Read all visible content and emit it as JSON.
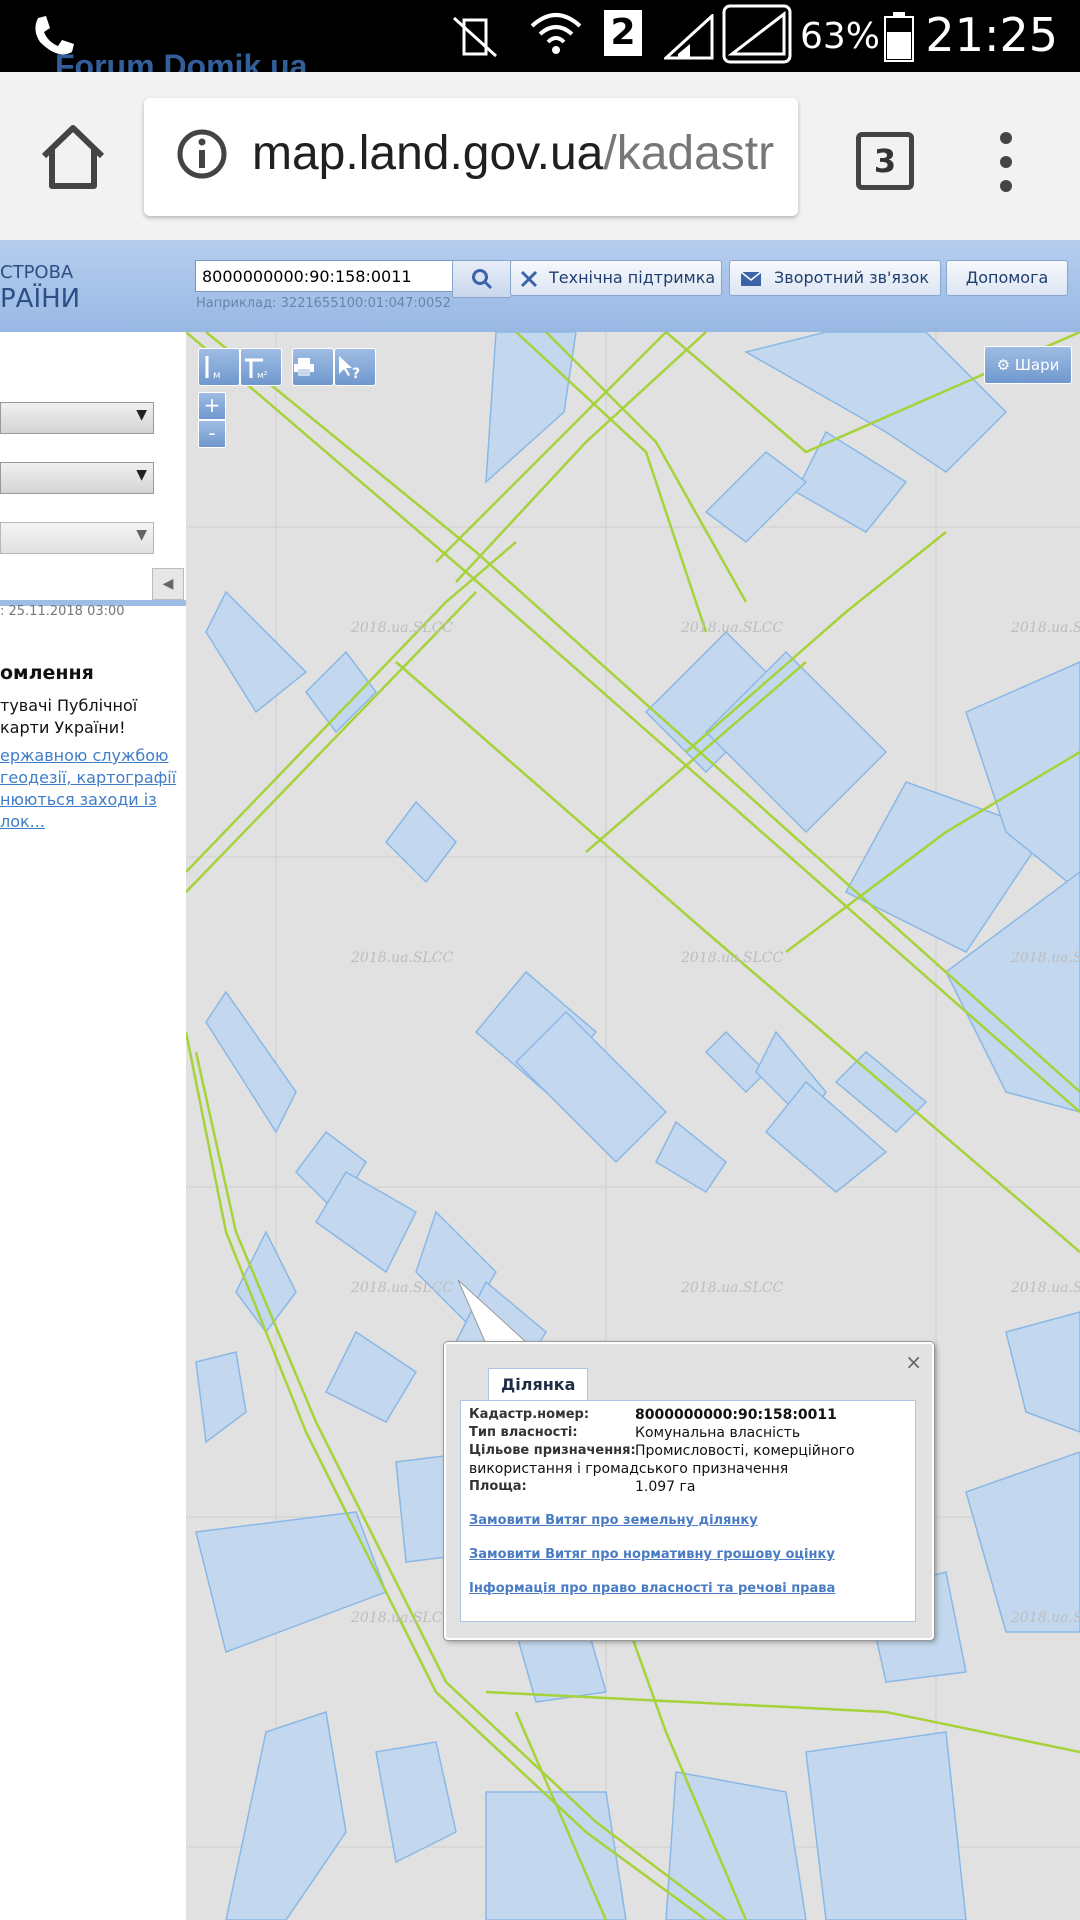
{
  "status_bar": {
    "battery_percent": "63%",
    "time": "21:25",
    "sim_slot": "2"
  },
  "watermark": "Forum.Domik.ua",
  "browser": {
    "url_host": "map.land.gov.ua",
    "url_path": "/kadastr",
    "tab_count": "3"
  },
  "header": {
    "title_line1": "СТРОВА",
    "title_line2": "РАЇНИ",
    "search_value": "8000000000:90:158:0011",
    "search_example": "Наприклад: 3221655100:01:047:0052",
    "support_label": "Технічна підтримка",
    "feedback_label": "Зворотний зв'язок",
    "help_label": "Допомога"
  },
  "left_panel": {
    "update_time": ": 25.11.2018 03:00",
    "notice_title": "омлення",
    "notice_lines": [
      "тувачі Публічної",
      "карти України!"
    ],
    "notice_link_lines": [
      "ержавною службою",
      "геодезії, картографії",
      "нюються заходи із",
      "лок..."
    ]
  },
  "map": {
    "layers_label": "Шари",
    "zoom_in": "+",
    "zoom_out": "-",
    "tile_watermark": "2018.ua.SLCC"
  },
  "popup": {
    "tab_label": "Ділянка",
    "close": "×",
    "fields": [
      {
        "label": "Кадастр.номер:",
        "value": "8000000000:90:158:0011"
      },
      {
        "label": "Тип власності:",
        "value": "Комунальна власність"
      },
      {
        "label": "Цільове призначення:",
        "value": "Промисловості, комерційного"
      },
      {
        "label": "Площа:",
        "value": "1.097 га"
      }
    ],
    "purpose_continuation": "використання і громадського призначення",
    "links": [
      "Замовити Витяг про земельну ділянку",
      "Замовити Витяг про нормативну грошову оцінку",
      "Інформація про право власності та речові права"
    ]
  },
  "colors": {
    "parcel_fill": "#c3d8ee",
    "parcel_stroke": "#8ab8e6",
    "boundary_line": "#a6d23a",
    "header_blue": "#98b8e4"
  }
}
